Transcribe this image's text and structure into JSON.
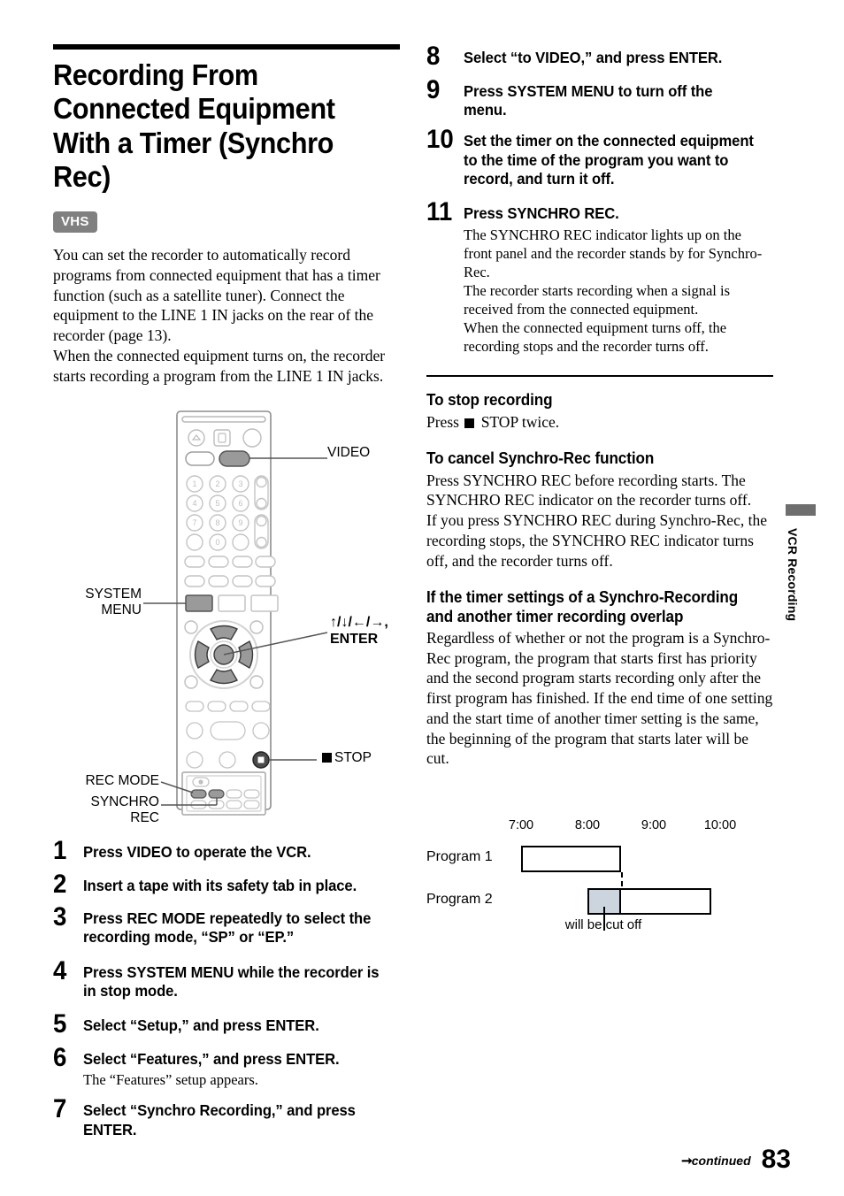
{
  "section": {
    "title": "Recording From Connected Equipment With a Timer (Synchro Rec)",
    "badge": "VHS",
    "intro_1": "You can set the recorder to automatically record programs from connected equipment that has a timer function (such as a satellite tuner). Connect the equipment to the LINE 1 IN jacks on the rear of the recorder (page 13).",
    "intro_2": "When the connected equipment turns on, the recorder starts recording a program from the LINE 1 IN jacks."
  },
  "steps": [
    {
      "num": "1",
      "text": "Press VIDEO to operate the VCR."
    },
    {
      "num": "2",
      "text": "Insert a tape with its safety tab in place."
    },
    {
      "num": "3",
      "text": "Press REC MODE repeatedly to select the recording mode, “SP” or “EP.”"
    },
    {
      "num": "4",
      "text": "Press SYSTEM MENU while the recorder is in stop mode."
    },
    {
      "num": "5",
      "text": "Select “Setup,” and press ENTER."
    },
    {
      "num": "6",
      "text": "Select “Features,” and press ENTER.",
      "note": "The “Features” setup appears."
    },
    {
      "num": "7",
      "text": "Select “Synchro Recording,” and press ENTER."
    },
    {
      "num": "8",
      "text": "Select “to VIDEO,” and press ENTER."
    },
    {
      "num": "9",
      "text": "Press SYSTEM MENU to turn off the menu."
    },
    {
      "num": "10",
      "text": "Set the timer on the connected equipment to the time of the program you want to record, and turn it off."
    },
    {
      "num": "11",
      "text": "Press SYNCHRO REC.",
      "note": "The SYNCHRO REC indicator lights up on the front panel and the recorder stands by for Synchro-Rec.\nThe recorder starts recording when a signal is received from the connected equipment.\nWhen the connected equipment turns off, the recording stops and the recorder turns off."
    }
  ],
  "subsections": [
    {
      "heading": "To stop recording",
      "body_prefix": "Press ",
      "body_suffix": " STOP twice."
    },
    {
      "heading": "To cancel Synchro-Rec function",
      "body": "Press SYNCHRO REC before recording starts. The SYNCHRO REC indicator on the recorder turns off.\nIf you press SYNCHRO REC during Synchro-Rec, the recording stops, the SYNCHRO REC indicator turns off, and the recorder turns off."
    },
    {
      "heading": "If the timer settings of a Synchro-Recording and another timer recording overlap",
      "body": "Regardless of whether or not the program is a Synchro-Rec program, the program that starts first has priority and the second program starts recording only after the first program has finished. If the end time of one setting and the start time of another timer setting is the same, the beginning of the program that starts later will be cut."
    }
  ],
  "remote_callouts": {
    "video": "VIDEO",
    "system_menu": "SYSTEM\nMENU",
    "arrows_enter": "↑/↓/←/→,\nENTER",
    "stop": "STOP",
    "rec_mode": "REC MODE",
    "synchro_rec": "SYNCHRO\nREC",
    "keypad": [
      "1",
      "2",
      "3",
      "4",
      "5",
      "6",
      "7",
      "8",
      "9",
      "0"
    ]
  },
  "chart_data": {
    "type": "bar",
    "orientation": "horizontal-timeline",
    "title": "",
    "xlabel": "",
    "ylabel": "",
    "tick_labels": [
      "7:00",
      "8:00",
      "9:00",
      "10:00"
    ],
    "tick_values": [
      7,
      8,
      9,
      10
    ],
    "xlim": [
      6.6,
      10.5
    ],
    "grid": false,
    "categories": [
      "Program 1",
      "Program 2"
    ],
    "series": [
      {
        "name": "Program 1",
        "start": 7.0,
        "end": 8.5,
        "fill": "white",
        "cut_end": null
      },
      {
        "name": "Program 2",
        "start": 8.0,
        "end": 10.3,
        "fill": "white",
        "cut_end": 8.5
      }
    ],
    "annotations": [
      {
        "text": "will be cut off",
        "at": 8.25,
        "target": "Program 2 shaded region"
      }
    ],
    "colors": {
      "cut_fill": "#ccd4dd",
      "outline": "#000000"
    }
  },
  "side_tab": {
    "label": "VCR Recording"
  },
  "footer": {
    "continued": "continued",
    "page": "83"
  }
}
